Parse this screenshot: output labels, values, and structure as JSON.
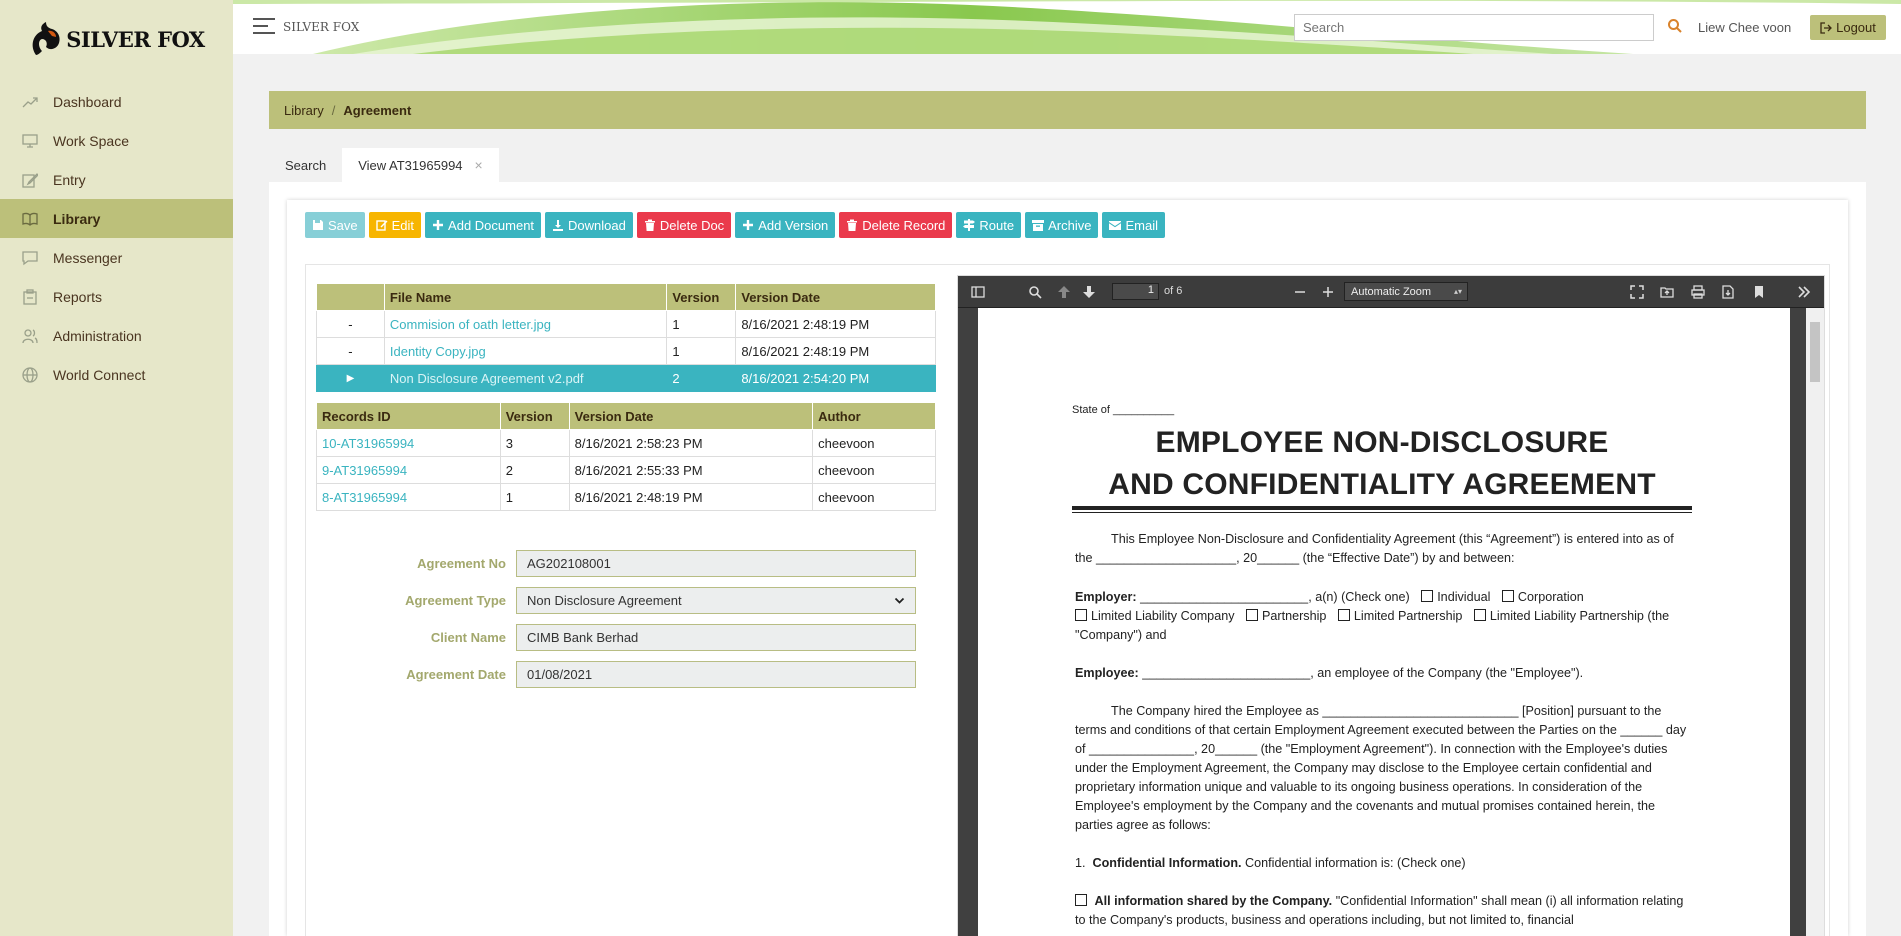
{
  "app": {
    "brand_first": "SILVER",
    "brand_second": "FOX",
    "header_brand": "SILVER FOX"
  },
  "header": {
    "search_placeholder": "Search",
    "user_name": "Liew Chee voon",
    "logout_label": "Logout"
  },
  "sidebar": {
    "items": [
      {
        "label": "Dashboard",
        "icon": "trend-icon"
      },
      {
        "label": "Work Space",
        "icon": "monitor-icon"
      },
      {
        "label": "Entry",
        "icon": "edit-icon"
      },
      {
        "label": "Library",
        "icon": "book-icon",
        "active": true
      },
      {
        "label": "Messenger",
        "icon": "chat-icon"
      },
      {
        "label": "Reports",
        "icon": "clipboard-icon"
      },
      {
        "label": "Administration",
        "icon": "users-icon"
      },
      {
        "label": "World Connect",
        "icon": "globe-icon"
      }
    ]
  },
  "breadcrumb": {
    "parent": "Library",
    "separator": "/",
    "current": "Agreement"
  },
  "tabs": {
    "search": "Search",
    "view": "View AT31965994",
    "close": "×"
  },
  "toolbar": {
    "save": "Save",
    "edit": "Edit",
    "add_document": "Add Document",
    "download": "Download",
    "delete_doc": "Delete Doc",
    "add_version": "Add Version",
    "delete_record": "Delete Record",
    "route": "Route",
    "archive": "Archive",
    "email": "Email"
  },
  "files_table": {
    "headers": [
      "",
      "File Name",
      "Version",
      "Version Date"
    ],
    "rows": [
      {
        "marker": "-",
        "name": "Commision of oath letter.jpg",
        "version": "1",
        "date": "8/16/2021 2:48:19 PM"
      },
      {
        "marker": "-",
        "name": "Identity Copy.jpg",
        "version": "1",
        "date": "8/16/2021 2:48:19 PM"
      },
      {
        "marker": "▶",
        "name": "Non Disclosure Agreement v2.pdf",
        "version": "2",
        "date": "8/16/2021 2:54:20 PM"
      }
    ]
  },
  "records_table": {
    "headers": [
      "Records ID",
      "Version",
      "Version Date",
      "Author"
    ],
    "rows": [
      {
        "id": "10-AT31965994",
        "version": "3",
        "date": "8/16/2021 2:58:23 PM",
        "author": "cheevoon"
      },
      {
        "id": "9-AT31965994",
        "version": "2",
        "date": "8/16/2021 2:55:33 PM",
        "author": "cheevoon"
      },
      {
        "id": "8-AT31965994",
        "version": "1",
        "date": "8/16/2021 2:48:19 PM",
        "author": "cheevoon"
      }
    ]
  },
  "form": {
    "agreement_no": {
      "label": "Agreement No",
      "value": "AG202108001"
    },
    "agreement_type": {
      "label": "Agreement Type",
      "value": "Non Disclosure Agreement"
    },
    "client_name": {
      "label": "Client Name",
      "value": "CIMB Bank Berhad"
    },
    "agreement_date": {
      "label": "Agreement Date",
      "value": "01/08/2021"
    }
  },
  "pdf_viewer": {
    "page": "1",
    "page_count": "of 6",
    "zoom": "Automatic Zoom",
    "doc": {
      "state": "State of __________",
      "title_line1": "EMPLOYEE NON-DISCLOSURE",
      "title_line2": "AND CONFIDENTIALITY AGREEMENT",
      "intro": "This Employee Non-Disclosure and Confidentiality Agreement (this “Agreement”) is entered into as of the ____________________, 20______ (the “Effective Date”) by and between:",
      "employer_label": "Employer:",
      "employer_text": "________________________, a(n) (Check one)",
      "opt_individual": "Individual",
      "opt_corporation": "Corporation",
      "opt_llc": "Limited Liability Company",
      "opt_partnership": "Partnership",
      "opt_lp": "Limited Partnership",
      "opt_llp": "Limited Liability Partnership (the \"Company\") and",
      "employee_label": "Employee:",
      "employee_text": "________________________, an employee of the Company (the \"Employee\").",
      "hired": "The Company hired the Employee as ____________________________ [Position] pursuant to the terms and conditions of that certain Employment Agreement executed between the Parties on the ______ day of _______________, 20______ (the \"Employment Agreement\"). In connection with the Employee's duties under the Employment Agreement, the Company may disclose to the Employee certain confidential and proprietary information unique and valuable to its ongoing business operations. In consideration of the Employee's employment by the Company and the covenants and mutual promises contained herein, the parties agree as follows:",
      "section1_num": "1.",
      "section1_title": "Confidential Information.",
      "section1_text": "Confidential information is: (Check one)",
      "all_info_title": "All information shared by the Company.",
      "all_info_text": "\"Confidential Information\" shall mean (i) all information relating to the Company's products, business and operations including, but not limited to, financial"
    }
  },
  "colors": {
    "accent": "#bcc07a",
    "teal": "#3ab4c0",
    "yellow": "#f7b500",
    "red": "#ea3a4c",
    "sidebar": "#e6e7c9"
  }
}
